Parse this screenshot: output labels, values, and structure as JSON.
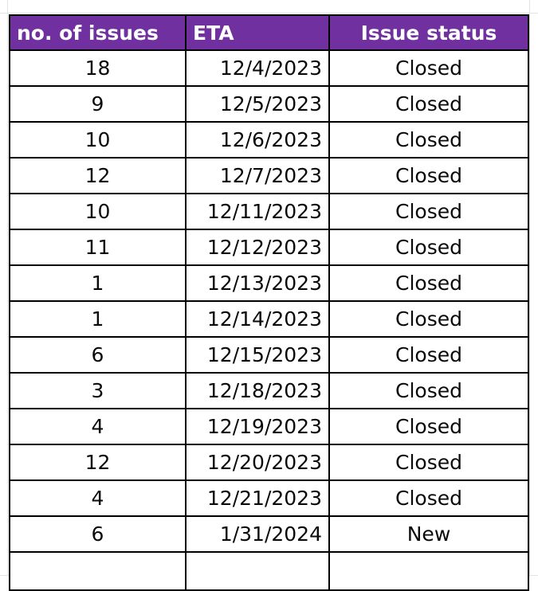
{
  "table": {
    "accent_color": "#7030A0",
    "header_text_color": "#FFFFFF",
    "border_color": "#000000",
    "columns": [
      {
        "key": "count",
        "label": "no. of issues"
      },
      {
        "key": "eta",
        "label": "ETA"
      },
      {
        "key": "status",
        "label": "Issue status"
      }
    ],
    "rows": [
      {
        "count": "18",
        "eta": "12/4/2023",
        "status": "Closed"
      },
      {
        "count": "9",
        "eta": "12/5/2023",
        "status": "Closed"
      },
      {
        "count": "10",
        "eta": "12/6/2023",
        "status": "Closed"
      },
      {
        "count": "12",
        "eta": "12/7/2023",
        "status": "Closed"
      },
      {
        "count": "10",
        "eta": "12/11/2023",
        "status": "Closed"
      },
      {
        "count": "11",
        "eta": "12/12/2023",
        "status": "Closed"
      },
      {
        "count": "1",
        "eta": "12/13/2023",
        "status": "Closed"
      },
      {
        "count": "1",
        "eta": "12/14/2023",
        "status": "Closed"
      },
      {
        "count": "6",
        "eta": "12/15/2023",
        "status": "Closed"
      },
      {
        "count": "3",
        "eta": "12/18/2023",
        "status": "Closed"
      },
      {
        "count": "4",
        "eta": "12/19/2023",
        "status": "Closed"
      },
      {
        "count": "12",
        "eta": "12/20/2023",
        "status": "Closed"
      },
      {
        "count": "4",
        "eta": "12/21/2023",
        "status": "Closed"
      },
      {
        "count": "6",
        "eta": "1/31/2024",
        "status": "New"
      }
    ],
    "trailing_empty_row": {
      "count": "",
      "eta": "",
      "status": ""
    }
  }
}
